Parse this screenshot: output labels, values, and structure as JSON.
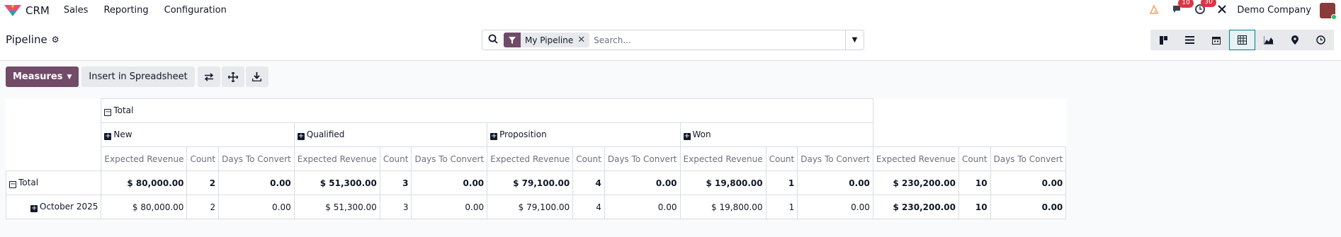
{
  "app": {
    "name": "CRM"
  },
  "nav": {
    "items": [
      "Sales",
      "Reporting",
      "Configuration"
    ]
  },
  "systray": {
    "messages_count": "10",
    "activities_count": "30",
    "company": "Demo Company"
  },
  "control": {
    "title": "Pipeline",
    "search": {
      "facet_label": "My Pipeline",
      "placeholder": "Search..."
    }
  },
  "toolbar": {
    "measures_label": "Measures",
    "insert_label": "Insert in Spreadsheet"
  },
  "pivot": {
    "col_total_label": "Total",
    "stages": [
      "New",
      "Qualified",
      "Proposition",
      "Won"
    ],
    "measures": [
      "Expected Revenue",
      "Count",
      "Days To Convert"
    ],
    "rows": [
      {
        "label": "Total",
        "values": [
          [
            "$ 80,000.00",
            "2",
            "0.00"
          ],
          [
            "$ 51,300.00",
            "3",
            "0.00"
          ],
          [
            "$ 79,100.00",
            "4",
            "0.00"
          ],
          [
            "$ 19,800.00",
            "1",
            "0.00"
          ],
          [
            "$ 230,200.00",
            "10",
            "0.00"
          ]
        ]
      },
      {
        "label": "October 2025",
        "values": [
          [
            "$ 80,000.00",
            "2",
            "0.00"
          ],
          [
            "$ 51,300.00",
            "3",
            "0.00"
          ],
          [
            "$ 79,100.00",
            "4",
            "0.00"
          ],
          [
            "$ 19,800.00",
            "1",
            "0.00"
          ],
          [
            "$ 230,200.00",
            "10",
            "0.00"
          ]
        ]
      }
    ]
  },
  "colors": {
    "primary": "#714b67",
    "accent": "#017e84",
    "badge": "#dc3545"
  }
}
